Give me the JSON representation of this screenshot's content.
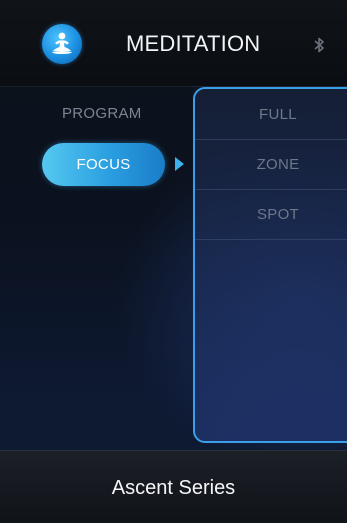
{
  "header": {
    "title": "MEDITATION",
    "logo_icon": "meditation-person-icon",
    "status_icon": "bluetooth-icon"
  },
  "sidebar": {
    "program_label": "PROGRAM",
    "selected_label": "FOCUS"
  },
  "options": [
    {
      "label": "FULL"
    },
    {
      "label": "ZONE"
    },
    {
      "label": "SPOT"
    }
  ],
  "footer": {
    "brand": "Ascent Series"
  },
  "colors": {
    "accent": "#2a9fe0",
    "border": "#3a9ee8",
    "muted_text": "#6d7889"
  }
}
